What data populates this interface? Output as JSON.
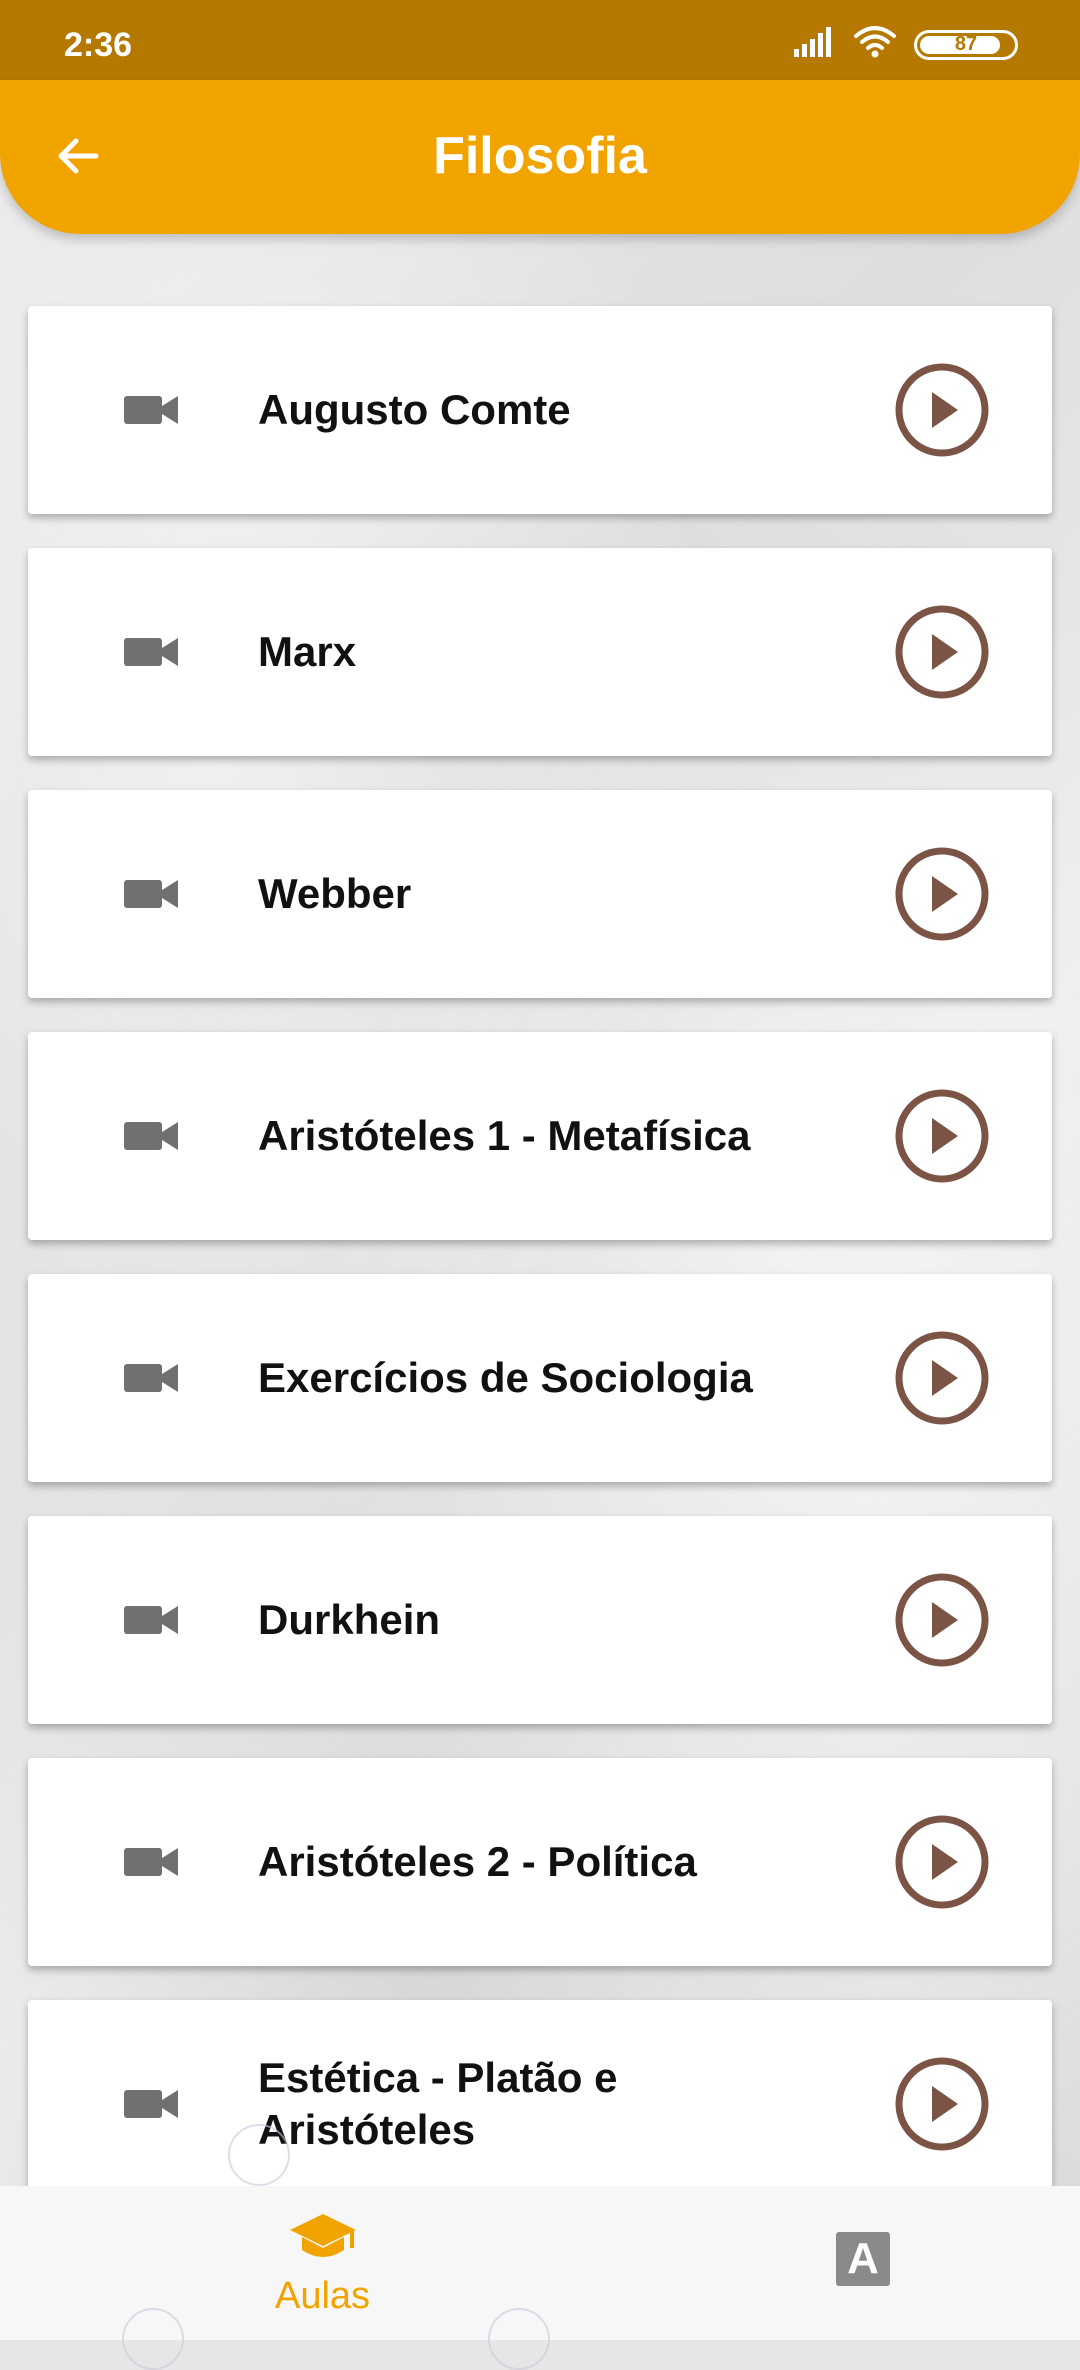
{
  "status": {
    "time": "2:36",
    "battery": "87"
  },
  "header": {
    "title": "Filosofia"
  },
  "lessons": [
    {
      "title": "Augusto Comte"
    },
    {
      "title": "Marx"
    },
    {
      "title": "Webber"
    },
    {
      "title": "Aristóteles 1 - Metafísica"
    },
    {
      "title": "Exercícios de Sociologia"
    },
    {
      "title": "Durkhein"
    },
    {
      "title": "Aristóteles 2 - Política"
    },
    {
      "title": "Estética - Platão e Aristóteles"
    }
  ],
  "bottom_nav": {
    "aulas_label": "Aulas",
    "second_icon_letter": "A"
  },
  "colors": {
    "status_bar": "#b57800",
    "app_bar": "#f1a400",
    "play_icon": "#7b5446",
    "camera_icon": "#707070",
    "active_nav": "#f1a400"
  }
}
